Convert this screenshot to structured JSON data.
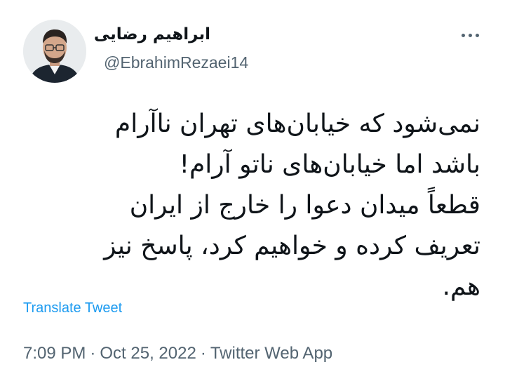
{
  "author": {
    "display_name": "ابراهیم رضایی",
    "handle": "@EbrahimRezaei14"
  },
  "tweet": {
    "lines": [
      "نمی‌شود که خیابان‌های تهران ناآرام",
      "باشد اما خیابان‌های ناتو آرام!",
      "قطعاً میدان دعوا را خارج از ایران",
      "تعریف کرده و خواهیم کرد، پاسخ نیز",
      "هم."
    ],
    "translate_label": "Translate Tweet"
  },
  "meta": {
    "time": "7:09 PM",
    "separator": "·",
    "date": "Oct 25, 2022",
    "source": "Twitter Web App"
  },
  "icons": {
    "more": "more-horizontal-icon"
  },
  "colors": {
    "link": "#1d9bf0",
    "secondary_text": "#536471",
    "primary_text": "#0f1419"
  }
}
